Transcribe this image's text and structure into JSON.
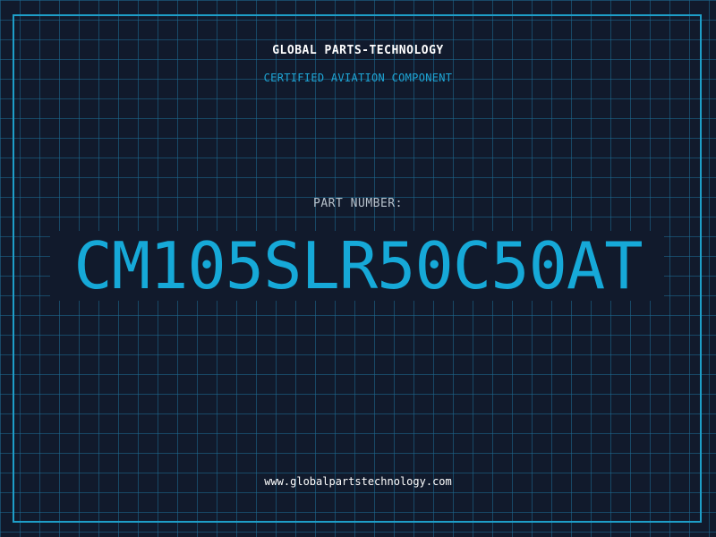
{
  "header": {
    "company": "GLOBAL PARTS-TECHNOLOGY",
    "subtitle": "CERTIFIED AVIATION COMPONENT"
  },
  "part": {
    "label": "PART NUMBER:",
    "number": "CM105SLR50C50AT"
  },
  "footer": {
    "url": "www.globalpartstechnology.com"
  },
  "colors": {
    "background": "#111a2c",
    "grid": "#1e6e96",
    "frame": "#1e9ec8",
    "accent": "#16a9d8",
    "label": "#b8c2cc",
    "text": "#ffffff"
  }
}
